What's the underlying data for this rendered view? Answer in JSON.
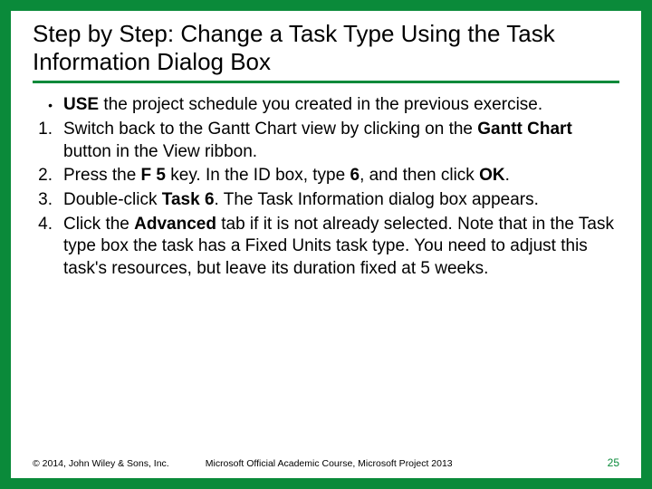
{
  "title": "Step by Step: Change a Task Type Using the Task Information Dialog Box",
  "items": [
    {
      "marker": "•",
      "parts": [
        {
          "t": "USE",
          "b": true
        },
        {
          "t": " the project schedule you created in the previous exercise.",
          "b": false
        }
      ]
    },
    {
      "marker": "1.",
      "parts": [
        {
          "t": "Switch back to the Gantt Chart view by clicking on the ",
          "b": false
        },
        {
          "t": "Gantt Chart",
          "b": true
        },
        {
          "t": " button in the View ribbon.",
          "b": false
        }
      ]
    },
    {
      "marker": "2.",
      "parts": [
        {
          "t": "Press the ",
          "b": false
        },
        {
          "t": "F 5",
          "b": true
        },
        {
          "t": " key. In the ID box, type ",
          "b": false
        },
        {
          "t": "6",
          "b": true
        },
        {
          "t": ", and then click ",
          "b": false
        },
        {
          "t": "OK",
          "b": true
        },
        {
          "t": ".",
          "b": false
        }
      ]
    },
    {
      "marker": "3.",
      "parts": [
        {
          "t": "Double-click ",
          "b": false
        },
        {
          "t": "Task 6",
          "b": true
        },
        {
          "t": ". The Task Information dialog box appears.",
          "b": false
        }
      ]
    },
    {
      "marker": "4.",
      "parts": [
        {
          "t": "Click the ",
          "b": false
        },
        {
          "t": "Advanced",
          "b": true
        },
        {
          "t": " tab if it is not already selected. Note that in the Task type box the task has a Fixed Units task type. You need to adjust this task's resources, but leave its duration fixed at 5 weeks.",
          "b": false
        }
      ]
    }
  ],
  "footer": {
    "left": "© 2014, John Wiley & Sons, Inc.",
    "mid": "Microsoft Official Academic Course, Microsoft Project 2013",
    "right": "25"
  }
}
